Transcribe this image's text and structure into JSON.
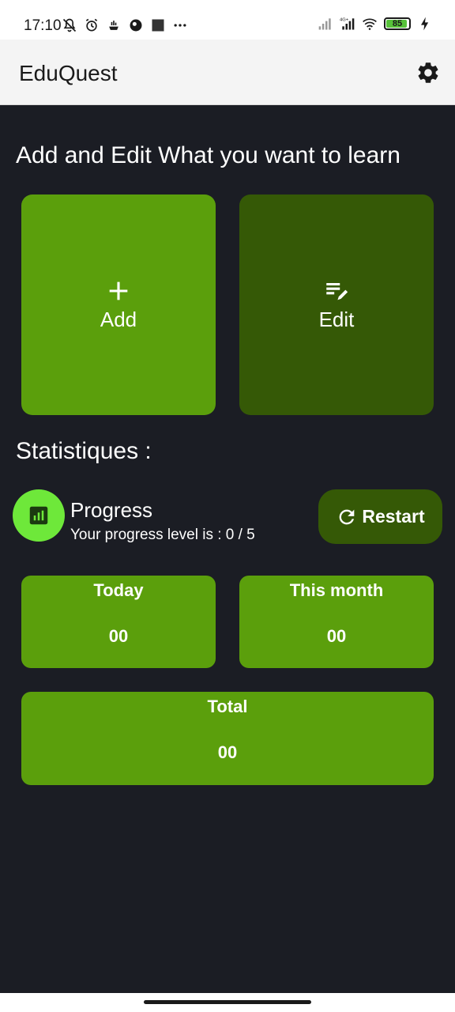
{
  "status_bar": {
    "time": "17:10",
    "left_icons": [
      "notifications-off-icon",
      "alarm-icon",
      "app-notification-icon",
      "app-notification-icon",
      "app-notification-icon",
      "more-dots-icon"
    ],
    "right_icons": [
      "signal-icon",
      "signal-4g-icon",
      "wifi-icon",
      "battery-icon",
      "charging-icon"
    ],
    "network_label": "4G+",
    "battery_level": "85"
  },
  "app_bar": {
    "title": "EduQuest",
    "settings_icon": "gear-icon"
  },
  "add_edit_section": {
    "title": "Add and Edit What you want to learn",
    "add": {
      "label": "Add",
      "icon": "plus-icon"
    },
    "edit": {
      "label": "Edit",
      "icon": "edit-list-icon"
    }
  },
  "statistics": {
    "title": "Statistiques :",
    "progress": {
      "icon": "bar-chart-icon",
      "title": "Progress",
      "subtitle": "Your progress level is : 0 / 5"
    },
    "restart": {
      "label": "Restart",
      "icon": "refresh-icon"
    },
    "cards": {
      "today": {
        "label": "Today",
        "value": "00"
      },
      "month": {
        "label": "This month",
        "value": "00"
      },
      "total": {
        "label": "Total",
        "value": "00"
      }
    }
  },
  "colors": {
    "background": "#1b1d24",
    "primary_green": "#5b9f0c",
    "dark_green": "#355906",
    "accent_green": "#6ee83a"
  }
}
